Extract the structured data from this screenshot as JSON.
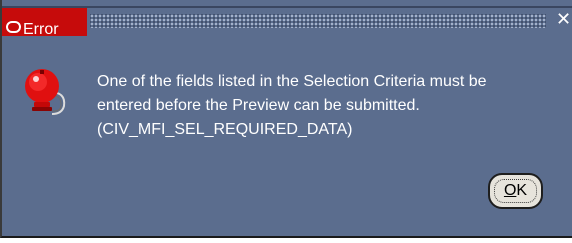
{
  "dialog": {
    "title": "Error",
    "close_glyph": "✕",
    "icon": "alarm-bell-icon",
    "message_lines": [
      "One of the fields listed in the Selection Criteria must be",
      "entered before the Preview can be submitted.",
      "(CIV_MFI_SEL_REQUIRED_DATA)"
    ],
    "ok_mnemonic": "O",
    "ok_rest": "K"
  },
  "colors": {
    "dialog_background": "#5b6d8e",
    "title_accent": "#c60b0b",
    "bell_red": "#e01010",
    "text": "#ffffff",
    "button_face": "#e7e4dc"
  }
}
